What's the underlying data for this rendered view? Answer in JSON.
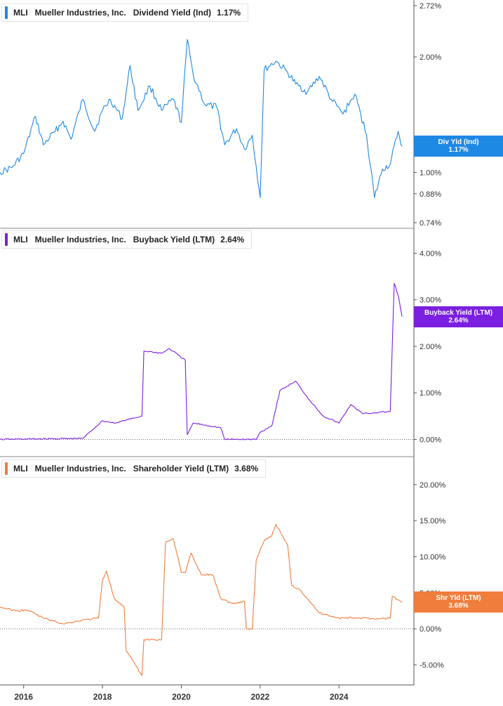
{
  "ticker": "MLI",
  "company": "Mueller Industries, Inc.",
  "colors": {
    "dividend": "#1e88e5",
    "buyback": "#7b1fe0",
    "shareholder": "#f07d3c",
    "axis": "#333333",
    "grid": "#bbbbbb"
  },
  "x_ticks": [
    "2016",
    "2018",
    "2020",
    "2022",
    "2024"
  ],
  "panels": [
    {
      "metric": "Dividend Yield (Ind)",
      "value": "1.17%",
      "tag_title": "Div Yld (Ind)",
      "tag_value": "1.17%",
      "ticks": [
        "2.72%",
        "2.00%",
        "1.00%",
        "0.88%",
        "0.74%"
      ]
    },
    {
      "metric": "Buyback Yield (LTM)",
      "value": "2.64%",
      "tag_title": "Buyback Yield (LTM)",
      "tag_value": "2.64%",
      "ticks": [
        "4.00%",
        "3.00%",
        "2.00%",
        "1.00%",
        "0.00%"
      ]
    },
    {
      "metric": "Shareholder Yield (LTM)",
      "value": "3.68%",
      "tag_title": "Shr Yld (LTM)",
      "tag_value": "3.68%",
      "ticks": [
        "20.00%",
        "15.00%",
        "10.00%",
        "5.00%",
        "0.00%",
        "-5.00%"
      ]
    }
  ],
  "chart_data": [
    {
      "type": "line",
      "title": "MLI Mueller Industries, Inc. Dividend Yield (Ind) 1.17%",
      "series": [
        {
          "name": "Dividend Yield (Ind)",
          "x": [
            2015.4,
            2015.7,
            2016.0,
            2016.3,
            2016.5,
            2016.8,
            2017.0,
            2017.2,
            2017.5,
            2017.8,
            2018.0,
            2018.2,
            2018.5,
            2018.7,
            2018.9,
            2019.2,
            2019.5,
            2019.8,
            2020.0,
            2020.15,
            2020.3,
            2020.6,
            2020.9,
            2021.1,
            2021.4,
            2021.6,
            2021.8,
            2022.0,
            2022.1,
            2022.4,
            2022.7,
            2022.9,
            2023.2,
            2023.5,
            2023.8,
            2024.1,
            2024.4,
            2024.7,
            2024.9,
            2025.1,
            2025.3,
            2025.5,
            2025.6
          ],
          "values": [
            1.0,
            1.03,
            1.12,
            1.4,
            1.18,
            1.28,
            1.36,
            1.22,
            1.55,
            1.28,
            1.45,
            1.55,
            1.38,
            1.9,
            1.45,
            1.68,
            1.45,
            1.55,
            1.35,
            2.22,
            1.8,
            1.5,
            1.48,
            1.18,
            1.3,
            1.15,
            1.25,
            0.86,
            1.85,
            1.95,
            1.82,
            1.7,
            1.62,
            1.78,
            1.55,
            1.42,
            1.6,
            1.25,
            0.86,
            1.02,
            1.05,
            1.28,
            1.17
          ]
        }
      ],
      "ylim": [
        0.74,
        2.72
      ],
      "y_scale": "log"
    },
    {
      "type": "line",
      "title": "MLI Mueller Industries, Inc. Buyback Yield (LTM) 2.64%",
      "series": [
        {
          "name": "Buyback Yield (LTM)",
          "x": [
            2015.4,
            2017.5,
            2018.0,
            2018.3,
            2019.0,
            2019.05,
            2019.5,
            2019.7,
            2020.1,
            2020.15,
            2020.3,
            2021.0,
            2021.1,
            2021.5,
            2021.9,
            2022.0,
            2022.3,
            2022.5,
            2022.6,
            2022.9,
            2023.2,
            2023.6,
            2024.0,
            2024.3,
            2024.6,
            2025.3,
            2025.4,
            2025.5,
            2025.6
          ],
          "values": [
            0.0,
            0.02,
            0.4,
            0.35,
            0.5,
            1.9,
            1.85,
            1.95,
            1.7,
            0.1,
            0.35,
            0.25,
            0.0,
            0.0,
            0.0,
            0.15,
            0.3,
            1.05,
            1.1,
            1.25,
            0.9,
            0.5,
            0.35,
            0.75,
            0.55,
            0.6,
            3.35,
            3.1,
            2.64
          ]
        }
      ],
      "ylim": [
        -0.25,
        4.4
      ]
    },
    {
      "type": "line",
      "title": "MLI Mueller Industries, Inc. Shareholder Yield (LTM) 3.68%",
      "series": [
        {
          "name": "Shareholder Yield (LTM)",
          "x": [
            2015.4,
            2015.8,
            2016.1,
            2016.5,
            2017.0,
            2017.5,
            2017.9,
            2018.0,
            2018.1,
            2018.3,
            2018.55,
            2018.6,
            2019.0,
            2019.05,
            2019.3,
            2019.5,
            2019.6,
            2019.8,
            2020.0,
            2020.1,
            2020.25,
            2020.5,
            2020.8,
            2021.0,
            2021.3,
            2021.6,
            2021.65,
            2021.8,
            2021.9,
            2022.1,
            2022.3,
            2022.4,
            2022.7,
            2022.8,
            2023.0,
            2023.5,
            2024.0,
            2024.5,
            2025.0,
            2025.3,
            2025.35,
            2025.6
          ],
          "values": [
            3.0,
            2.5,
            2.6,
            1.5,
            0.7,
            1.2,
            1.5,
            6.8,
            8.0,
            4.2,
            3.0,
            -3.0,
            -6.5,
            -1.5,
            -1.5,
            -1.5,
            12.0,
            12.5,
            7.8,
            7.8,
            10.5,
            7.5,
            7.5,
            4.2,
            3.5,
            3.8,
            0.0,
            0.0,
            9.5,
            12.2,
            13.0,
            14.5,
            11.5,
            6.0,
            5.5,
            2.2,
            1.5,
            1.5,
            1.4,
            1.5,
            4.5,
            3.68
          ]
        }
      ],
      "ylim": [
        -7.0,
        23.0
      ]
    }
  ]
}
